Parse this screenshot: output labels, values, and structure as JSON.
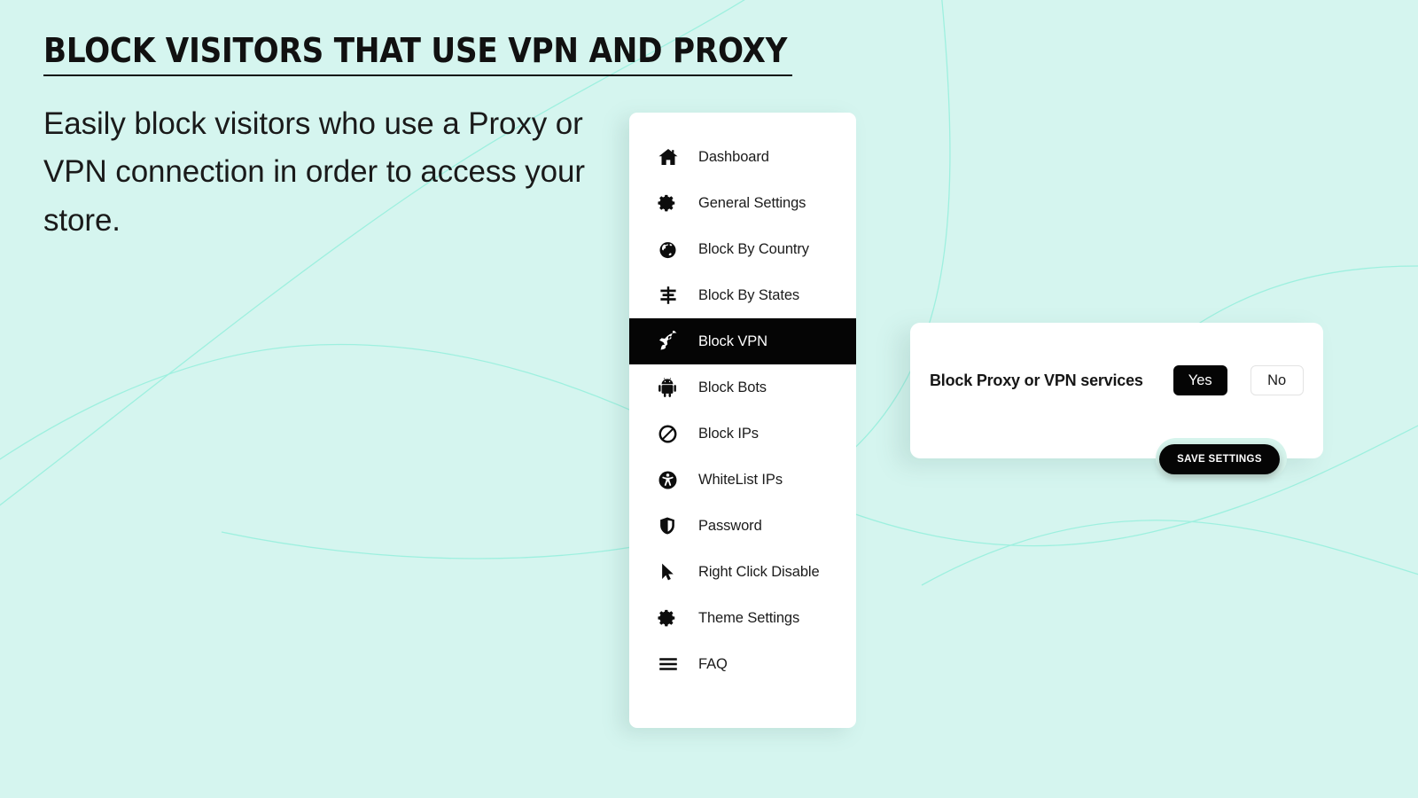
{
  "theme": {
    "background": "#d5f5ef",
    "accent_curve": "#9df2e0",
    "card_background": "#ffffff",
    "active_background": "#050505",
    "active_text": "#ffffff",
    "text": "#1b1b1b",
    "glow": "#d6f4ec"
  },
  "promo": {
    "title": "BLOCK VISITORS THAT USE VPN AND PROXY",
    "subtitle": "Easily block visitors who use a Proxy or VPN connection in order to access your store."
  },
  "sidebar": {
    "items": [
      {
        "label": "Dashboard",
        "icon": "home-icon",
        "active": false
      },
      {
        "label": "General Settings",
        "icon": "gear-icon",
        "active": false
      },
      {
        "label": "Block By Country",
        "icon": "globe-icon",
        "active": false
      },
      {
        "label": "Block By States",
        "icon": "signpost-icon",
        "active": false
      },
      {
        "label": "Block VPN",
        "icon": "rocket-icon",
        "active": true
      },
      {
        "label": "Block Bots",
        "icon": "android-robot-icon",
        "active": false
      },
      {
        "label": "Block IPs",
        "icon": "ban-icon",
        "active": false
      },
      {
        "label": "WhiteList IPs",
        "icon": "accessibility-icon",
        "active": false
      },
      {
        "label": "Password",
        "icon": "shield-icon",
        "active": false
      },
      {
        "label": "Right Click Disable",
        "icon": "cursor-arrow-icon",
        "active": false
      },
      {
        "label": "Theme Settings",
        "icon": "gear-icon",
        "active": false
      },
      {
        "label": "FAQ",
        "icon": "hamburger-icon",
        "active": false
      }
    ]
  },
  "settings": {
    "row_label": "Block Proxy or VPN services",
    "options": [
      {
        "label": "Yes",
        "selected": true
      },
      {
        "label": "No",
        "selected": false
      }
    ],
    "save_label": "SAVE SETTINGS"
  }
}
